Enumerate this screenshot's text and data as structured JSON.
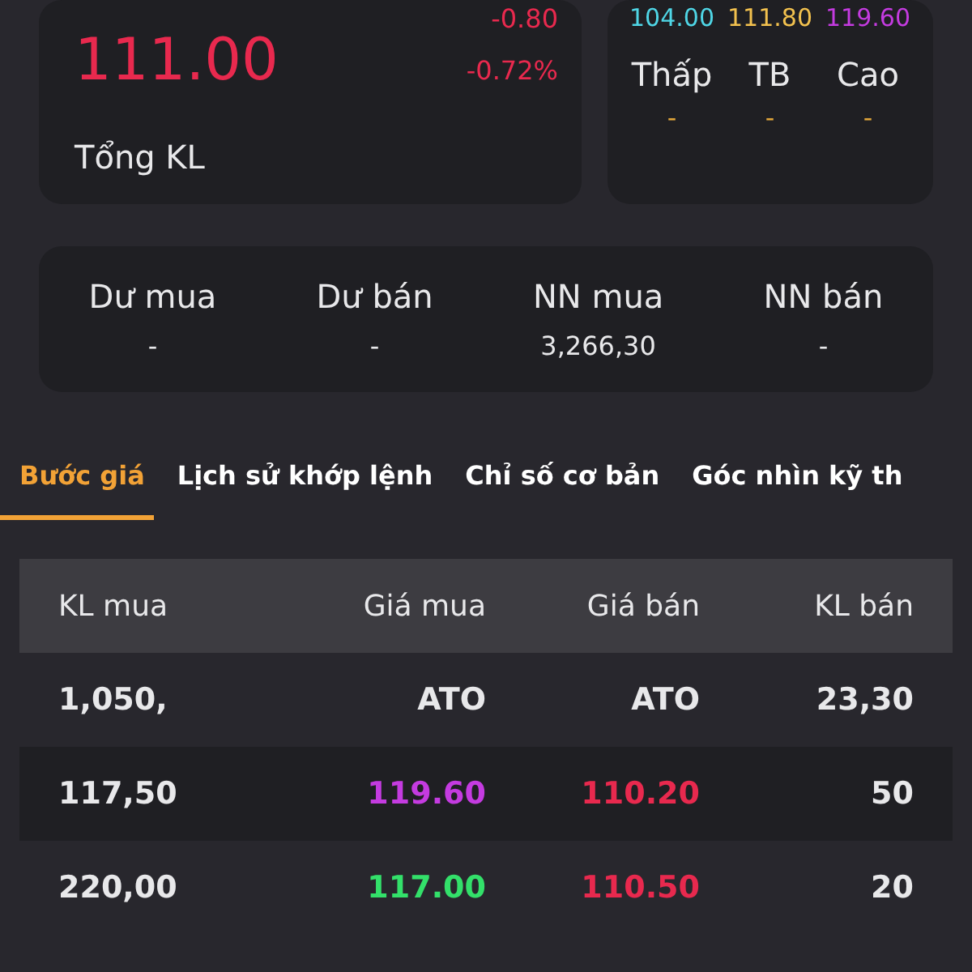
{
  "price_card": {
    "change": "-0.80",
    "price": "111.00",
    "change_percent": "-0.72%",
    "volume_label": "Tổng KL"
  },
  "range_card": {
    "values": [
      {
        "text": "104.00",
        "color": "#4fd6e6"
      },
      {
        "text": "111.80",
        "color": "#f2c14e"
      },
      {
        "text": "119.60",
        "color": "#c43be0"
      }
    ],
    "labels": [
      "Thấp",
      "TB",
      "Cao"
    ],
    "readings": [
      "-",
      "-",
      "-"
    ]
  },
  "order_summary": [
    {
      "label": "Dư mua",
      "value": "-"
    },
    {
      "label": "Dư bán",
      "value": "-"
    },
    {
      "label": "NN mua",
      "value": "3,266,30"
    },
    {
      "label": "NN bán",
      "value": "-"
    }
  ],
  "tabs": [
    {
      "label": "Bước giá",
      "selected": true
    },
    {
      "label": "Lịch sử khớp lệnh",
      "selected": false
    },
    {
      "label": "Chỉ số cơ bản",
      "selected": false
    },
    {
      "label": "Góc nhìn kỹ th",
      "selected": false
    }
  ],
  "order_book": {
    "columns": [
      "KL mua",
      "Giá mua",
      "Giá bán",
      "KL bán"
    ],
    "rows": [
      {
        "cells": [
          {
            "text": "1,050,"
          },
          {
            "text": "ATO"
          },
          {
            "text": "ATO"
          },
          {
            "text": "23,30"
          }
        ]
      },
      {
        "cells": [
          {
            "text": "117,50"
          },
          {
            "text": "119.60",
            "color": "#c43be0"
          },
          {
            "text": "110.20",
            "color": "#e8294e"
          },
          {
            "text": "50"
          }
        ]
      },
      {
        "cells": [
          {
            "text": "220,00"
          },
          {
            "text": "117.00",
            "color": "#33e06a"
          },
          {
            "text": "110.50",
            "color": "#e8294e"
          },
          {
            "text": "20"
          }
        ]
      }
    ]
  }
}
